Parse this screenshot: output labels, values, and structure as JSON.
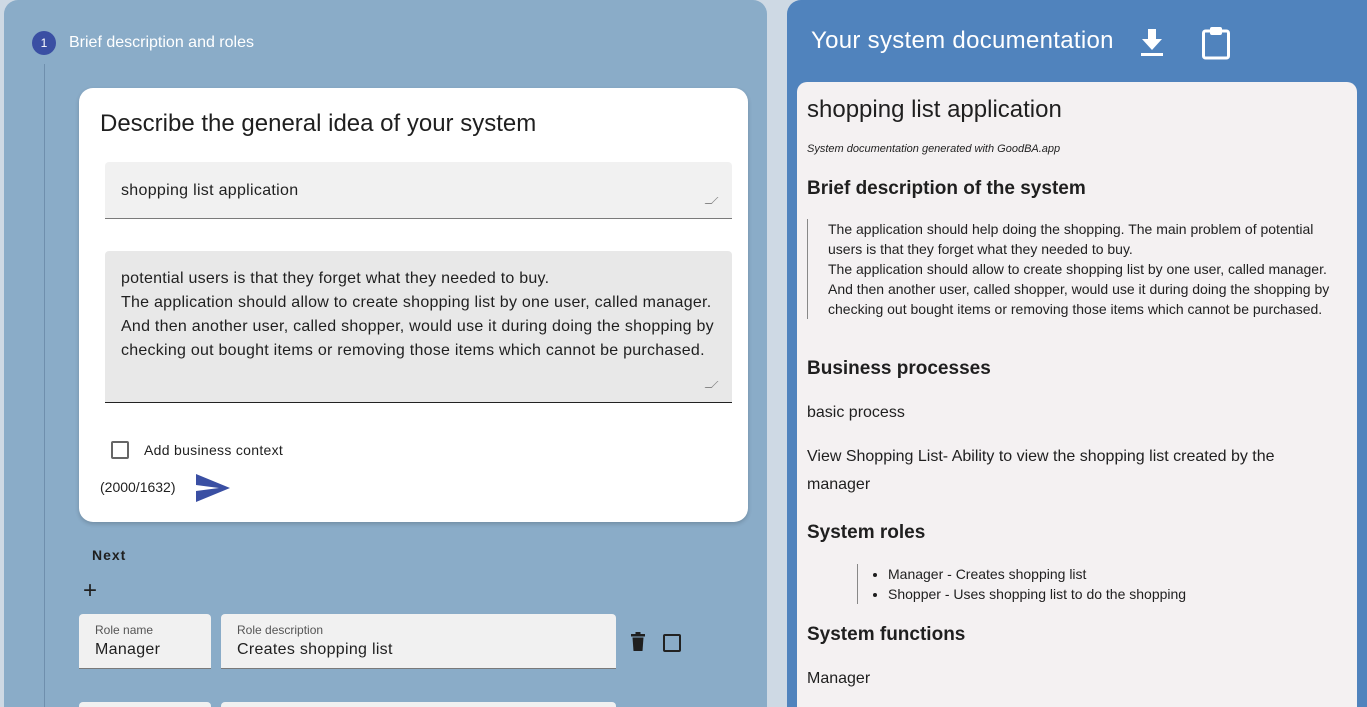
{
  "stepper": {
    "step_number": "1",
    "step_title": "Brief description and roles"
  },
  "card": {
    "title": "Describe the general idea of your system",
    "system_name_value": "shopping list application",
    "description_value": "potential users is that they forget what they needed to buy.\nThe application should allow to create shopping list by one user, called manager. And then another user, called shopper, would use it during doing the shopping by checking out bought items or removing those items which cannot be purchased.",
    "checkbox_label": "Add business context",
    "counter": "(2000/1632)"
  },
  "actions": {
    "next_label": "Next",
    "add_symbol": "+"
  },
  "role_row": {
    "name_label": "Role name",
    "name_value": "Manager",
    "desc_label": "Role description",
    "desc_value": "Creates shopping list"
  },
  "documentation": {
    "panel_title": "Your system documentation",
    "doc_title": "shopping list application",
    "generated_note": "System documentation generated with GoodBA.app",
    "brief_heading": "Brief description of the system",
    "brief_text": "The application should help doing the shopping. The main problem of potential users is that they forget what they needed to buy.\nThe application should allow to create shopping list by one user, called manager. And then another user, called shopper, would use it during doing the shopping by checking out bought items or removing those items which cannot be purchased.",
    "processes_heading": "Business processes",
    "process_1": "basic process",
    "process_2": "View Shopping List- Ability to view the shopping list created by the manager",
    "roles_heading": "System roles",
    "roles": [
      "Manager - Creates shopping list",
      "Shopper - Uses shopping list to do the shopping"
    ],
    "functions_heading": "System functions",
    "function_1": "Manager"
  },
  "icons": {
    "download": "download-icon",
    "clipboard": "clipboard-icon",
    "send": "send-icon",
    "trash": "trash-icon"
  },
  "colors": {
    "accent": "#3a4fa3",
    "left_panel": "#8aacc8",
    "right_panel": "#5083bd"
  }
}
